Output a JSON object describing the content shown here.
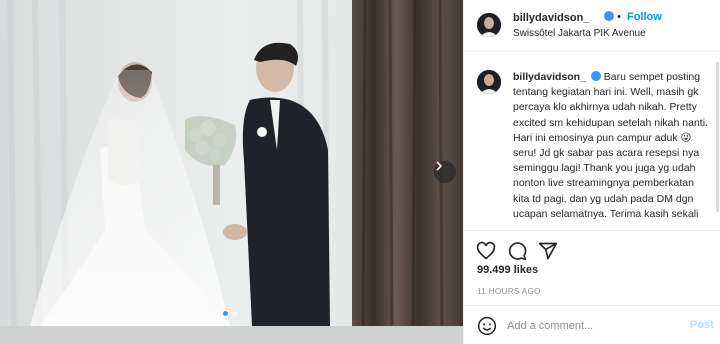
{
  "photo": {
    "alt_subject": "wedding-photo",
    "carousel": {
      "total": 2,
      "active": 1
    }
  },
  "header": {
    "username": "billydavidson_",
    "separator": "•",
    "follow_label": "Follow",
    "location": "Swissôtel Jakarta PIK Avenue"
  },
  "caption": {
    "username": "billydavidson_",
    "text": "Baru sempet posting tentang kegiatan hari ini. Well, masih gk percaya klo akhirnya udah nikah. Pretty excited sm kehidupan setelah nikah nanti. Hari ini emosinya pun campur aduk 😜 seru! Jd gk sabar pas acara resepsi nya seminggu lagi! Thank you juga yg udah nonton live streamingnya pemberkatan kita td pagi, dan yg udah pada DM dgn ucapan selamatnya. Terima kasih sekali"
  },
  "actions": {
    "icons": [
      "heart-icon",
      "comment-icon",
      "share-icon"
    ]
  },
  "likes": "99.499 likes",
  "timestamp": "11 HOURS AGO",
  "comment_box": {
    "placeholder": "Add a comment...",
    "post_label": "Post"
  },
  "colors": {
    "accent": "#0095f6",
    "verified": "#3897f0",
    "post_disabled": "#b2dffc",
    "muted": "#8e8e8e"
  }
}
